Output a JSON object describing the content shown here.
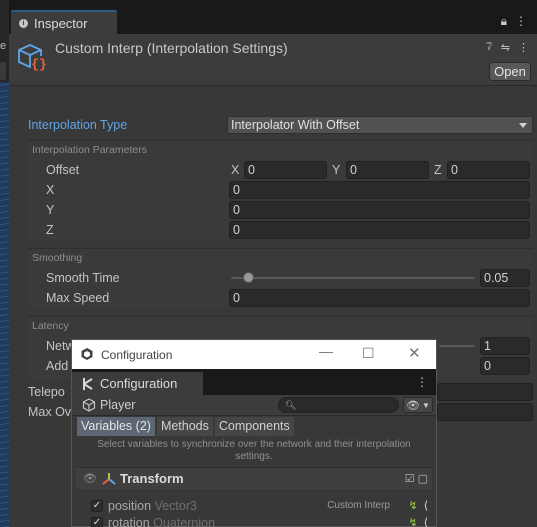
{
  "window": {
    "tab_title": "Inspector",
    "left_edge_text": "e"
  },
  "component": {
    "title": "Custom Interp (Interpolation Settings)",
    "open_label": "Open"
  },
  "interpolation_type": {
    "label": "Interpolation Type",
    "value": "Interpolator With Offset"
  },
  "params": {
    "section_title": "Interpolation Parameters",
    "offset_label": "Offset",
    "offset": {
      "x_axis": "X",
      "x": "0",
      "y_axis": "Y",
      "y": "0",
      "z_axis": "Z",
      "z": "0"
    },
    "x_label": "X",
    "x_value": "0",
    "y_label": "Y",
    "y_value": "0",
    "z_label": "Z",
    "z_value": "0"
  },
  "smoothing": {
    "section_title": "Smoothing",
    "smooth_time_label": "Smooth Time",
    "smooth_time_value": "0.05",
    "smooth_time_fraction": 0.07,
    "max_speed_label": "Max Speed",
    "max_speed_value": "0"
  },
  "latency": {
    "section_title": "Latency",
    "row1_label": "Netw",
    "row1_value": "1",
    "row2_label": "Add",
    "row2_value": "0"
  },
  "extra_rows": {
    "row1_label": "Telepo",
    "row2_label": "Max Ov"
  },
  "config_window": {
    "title": "Configuration",
    "tab_label": "Configuration",
    "object_name": "Player",
    "search_placeholder": "",
    "tabs": [
      "Variables (2)",
      "Methods",
      "Components"
    ],
    "hint": "Select variables to synchronize over the network and their interpolation settings.",
    "group_title": "Transform",
    "variables": [
      {
        "name": "position",
        "type": "Vector3",
        "interp": "Custom Interp",
        "checked": true
      },
      {
        "name": "rotation",
        "type": "Quaternion",
        "interp": "",
        "checked": true
      }
    ]
  },
  "colors": {
    "accent_blue": "#5ea6e6",
    "brand_orange": "#f0603a",
    "networking_green": "#9ccf4a"
  }
}
